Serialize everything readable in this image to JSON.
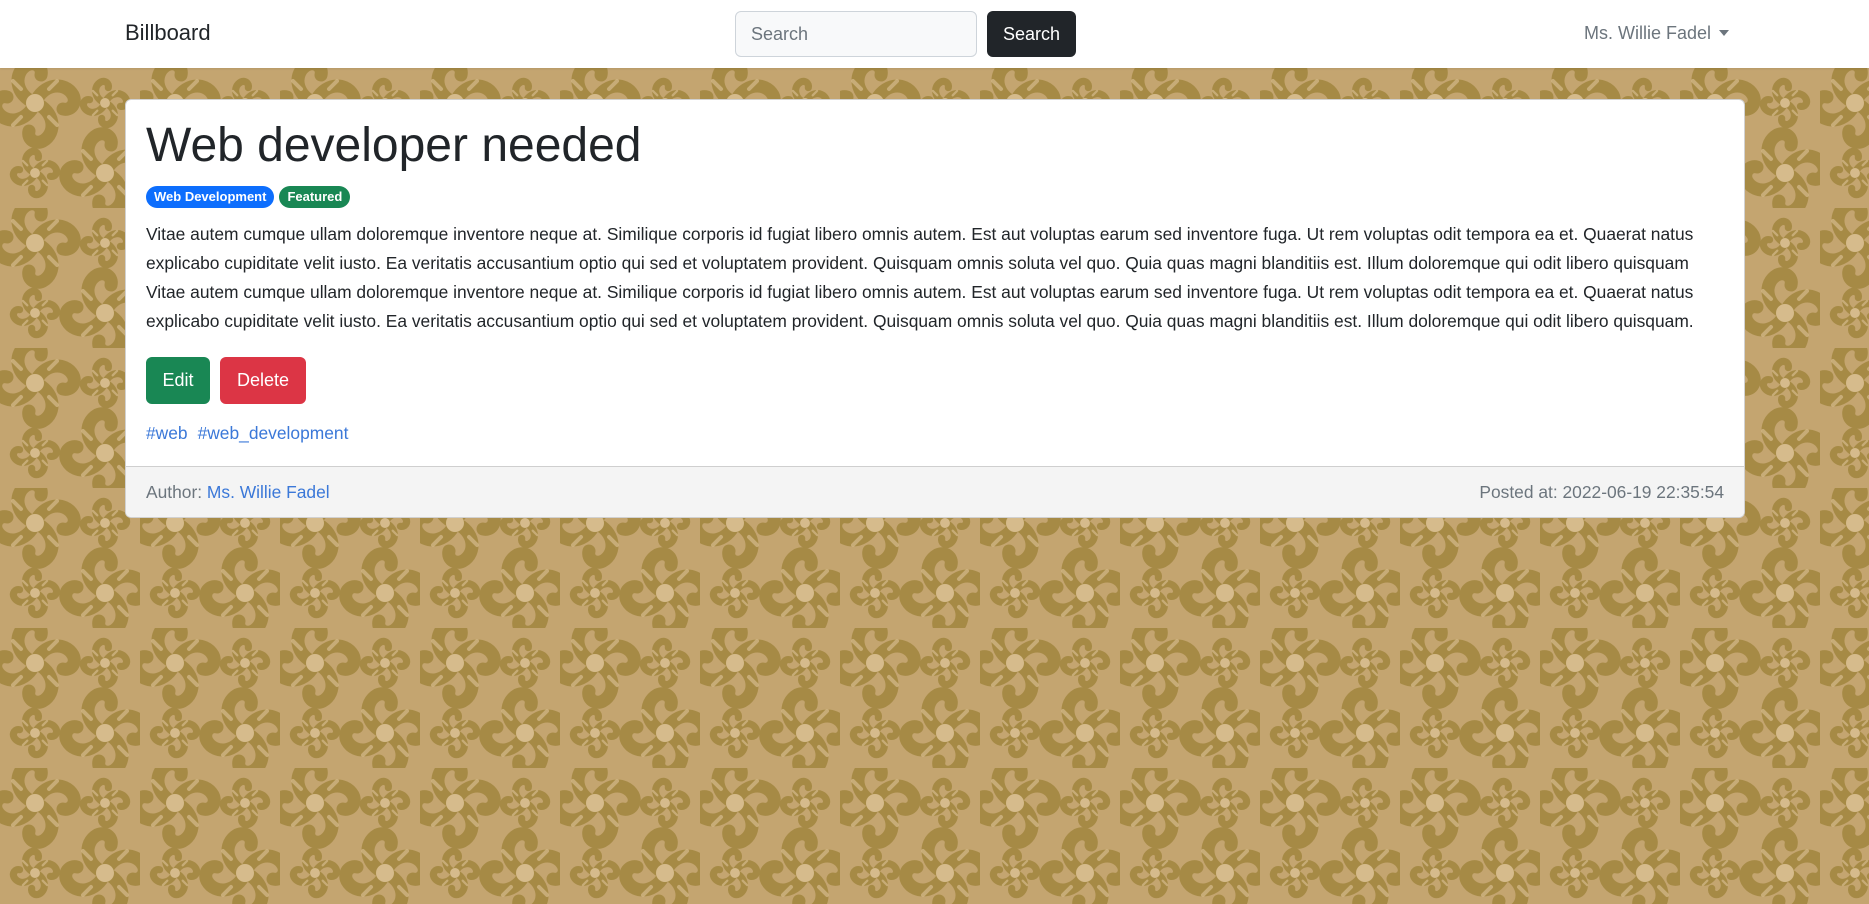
{
  "navbar": {
    "brand": "Billboard",
    "search_placeholder": "Search",
    "search_button": "Search",
    "user_name": "Ms. Willie Fadel"
  },
  "post": {
    "title": "Web developer needed",
    "badges": [
      "Web Development",
      "Featured"
    ],
    "body": "Vitae autem cumque ullam doloremque inventore neque at. Similique corporis id fugiat libero omnis autem. Est aut voluptas earum sed inventore fuga. Ut rem voluptas odit tempora ea et. Quaerat natus explicabo cupiditate velit iusto. Ea veritatis accusantium optio qui sed et voluptatem provident. Quisquam omnis soluta vel quo. Quia quas magni blanditiis est. Illum doloremque qui odit libero quisquam Vitae autem cumque ullam doloremque inventore neque at. Similique corporis id fugiat libero omnis autem. Est aut voluptas earum sed inventore fuga. Ut rem voluptas odit tempora ea et. Quaerat natus explicabo cupiditate velit iusto. Ea veritatis accusantium optio qui sed et voluptatem provident. Quisquam omnis soluta vel quo. Quia quas magni blanditiis est. Illum doloremque qui odit libero quisquam.",
    "edit_label": "Edit",
    "delete_label": "Delete",
    "tags": [
      "#web",
      "#web_development"
    ],
    "author_prefix": "Author:",
    "author_name": "Ms. Willie Fadel",
    "posted_at": "Posted at: 2022-06-19 22:35:54"
  },
  "colors": {
    "background": "#c4a570",
    "pattern_dark": "#a68a45",
    "pattern_light": "#d6bb8c",
    "primary": "#0d6efd",
    "success": "#198754",
    "danger": "#dc3545",
    "link": "#3b78d8"
  }
}
